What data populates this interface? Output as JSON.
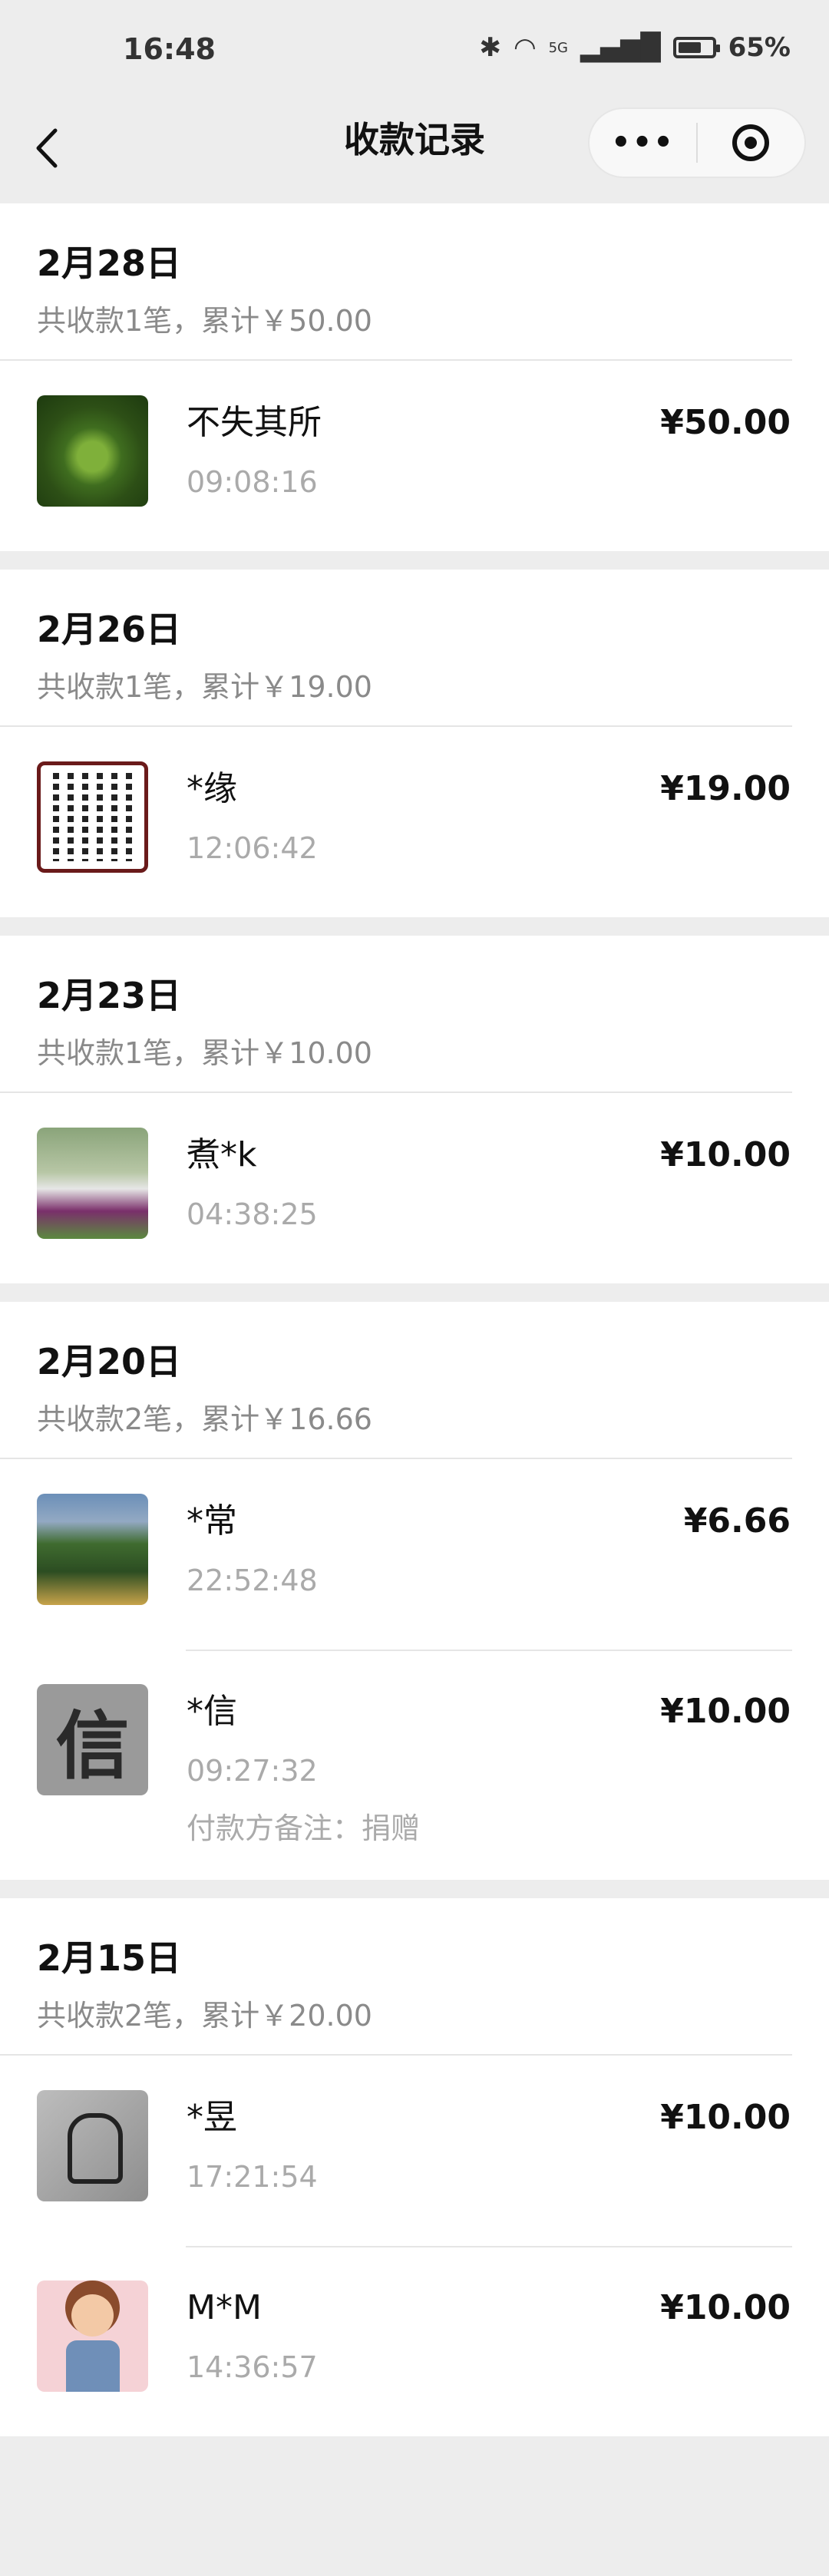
{
  "status_bar": {
    "time": "16:48",
    "network": "5G",
    "battery_percent": "65%"
  },
  "nav": {
    "back_icon": "chevron-left-icon",
    "title": "收款记录",
    "more_label": "•••",
    "target_icon": "target-icon"
  },
  "groups": [
    {
      "date": "2月28日",
      "summary": "共收款1笔，累计￥50.00",
      "records": [
        {
          "name": "不失其所",
          "time": "09:08:16",
          "amount": "¥50.00",
          "avatar": "leaf"
        }
      ]
    },
    {
      "date": "2月26日",
      "summary": "共收款1笔，累计￥19.00",
      "records": [
        {
          "name": "*缘",
          "time": "12:06:42",
          "amount": "¥19.00",
          "avatar": "calligraphy"
        }
      ]
    },
    {
      "date": "2月23日",
      "summary": "共收款1笔，累计￥10.00",
      "records": [
        {
          "name": "煮*k",
          "time": "04:38:25",
          "amount": "¥10.00",
          "avatar": "soccer"
        }
      ]
    },
    {
      "date": "2月20日",
      "summary": "共收款2笔，累计￥16.66",
      "records": [
        {
          "name": "*常",
          "time": "22:52:48",
          "amount": "¥6.66",
          "avatar": "tree"
        },
        {
          "name": "*信",
          "time": "09:27:32",
          "amount": "¥10.00",
          "avatar": "xin",
          "avatar_text": "信",
          "note": "付款方备注：捐赠"
        }
      ]
    },
    {
      "date": "2月15日",
      "summary": "共收款2笔，累计￥20.00",
      "records": [
        {
          "name": "*昱",
          "time": "17:21:54",
          "amount": "¥10.00",
          "avatar": "sketch"
        },
        {
          "name": "M*M",
          "time": "14:36:57",
          "amount": "¥10.00",
          "avatar": "girl"
        }
      ]
    }
  ]
}
